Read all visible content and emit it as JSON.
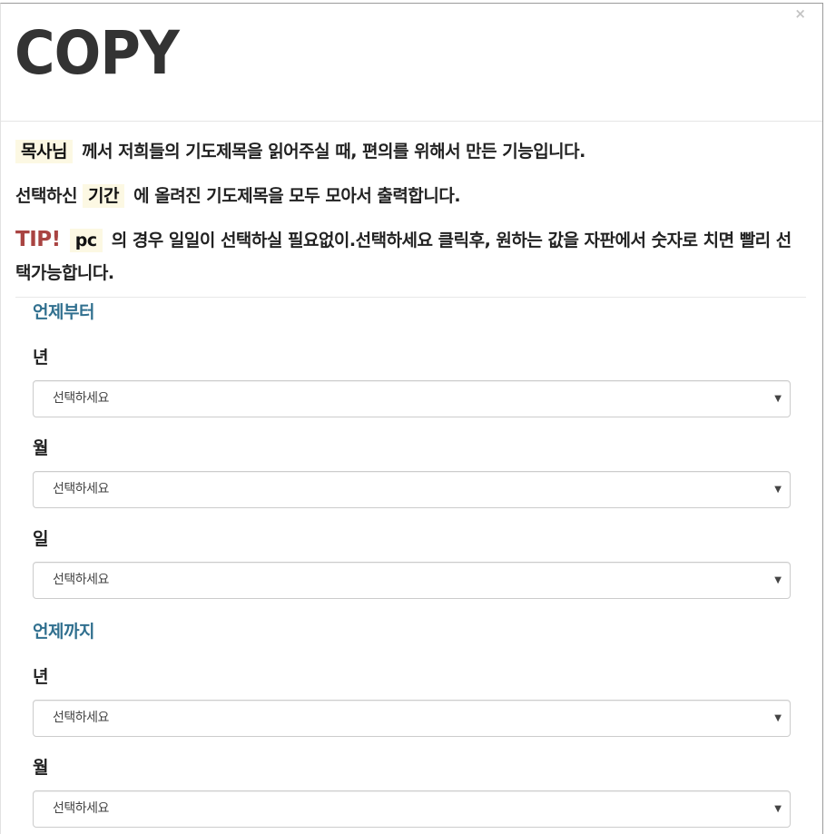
{
  "modal": {
    "title": "COPY",
    "close_icon": "×"
  },
  "intro": {
    "line1": {
      "mark": "목사님",
      "text": "께서 저희들의 기도제목을 읽어주실 때, 편의를 위해서 만든 기능입니다."
    },
    "line2": {
      "before": "선택하신",
      "mark": "기간",
      "text": "에 올려진 기도제목을 모두 모아서 출력합니다."
    },
    "line3": {
      "tip": "TIP!",
      "mark": "pc",
      "text": "의 경우 일일이 선택하실 필요없이.선택하세요 클릭후, 원하는 값을 자판에서 숫자로 치면 빨리 선택가능합니다."
    }
  },
  "from": {
    "title": "언제부터",
    "year_label": "년",
    "year_value": "선택하세요",
    "month_label": "월",
    "month_value": "선택하세요",
    "day_label": "일",
    "day_value": "선택하세요"
  },
  "to": {
    "title": "언제까지",
    "year_label": "년",
    "year_value": "선택하세요",
    "month_label": "월",
    "month_value": "선택하세요"
  },
  "icons": {
    "caret": "▼",
    "close": "close-icon"
  }
}
